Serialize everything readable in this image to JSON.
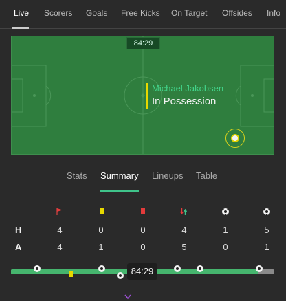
{
  "top_tabs": [
    {
      "label": "Live",
      "active": true
    },
    {
      "label": "Scorers"
    },
    {
      "label": "Goals"
    },
    {
      "label": "Free Kicks"
    },
    {
      "label": "On Target"
    },
    {
      "label": "Offsides"
    },
    {
      "label": "Info"
    }
  ],
  "pitch": {
    "clock": "84:29",
    "player": "Michael Jakobsen",
    "status": "In Possession"
  },
  "sub_tabs": [
    {
      "label": "Stats"
    },
    {
      "label": "Summary",
      "active": true
    },
    {
      "label": "Lineups"
    },
    {
      "label": "Table"
    }
  ],
  "stats": {
    "icons": [
      "corner-flag-icon",
      "yellow-card-icon",
      "red-card-icon",
      "substitution-icon",
      "shot-icon",
      "goal-ball-icon"
    ],
    "rows": [
      {
        "label": "H",
        "values": [
          "4",
          "0",
          "0",
          "4",
          "1",
          "5"
        ]
      },
      {
        "label": "A",
        "values": [
          "4",
          "1",
          "0",
          "5",
          "0",
          "1"
        ]
      }
    ]
  },
  "timeline": {
    "clock": "84:29",
    "progress": 0.94
  },
  "colors": {
    "accent": "#3fc38a",
    "pitch": "#2f7e3e",
    "card_yellow": "#e7d800",
    "card_red": "#e33b3b"
  }
}
